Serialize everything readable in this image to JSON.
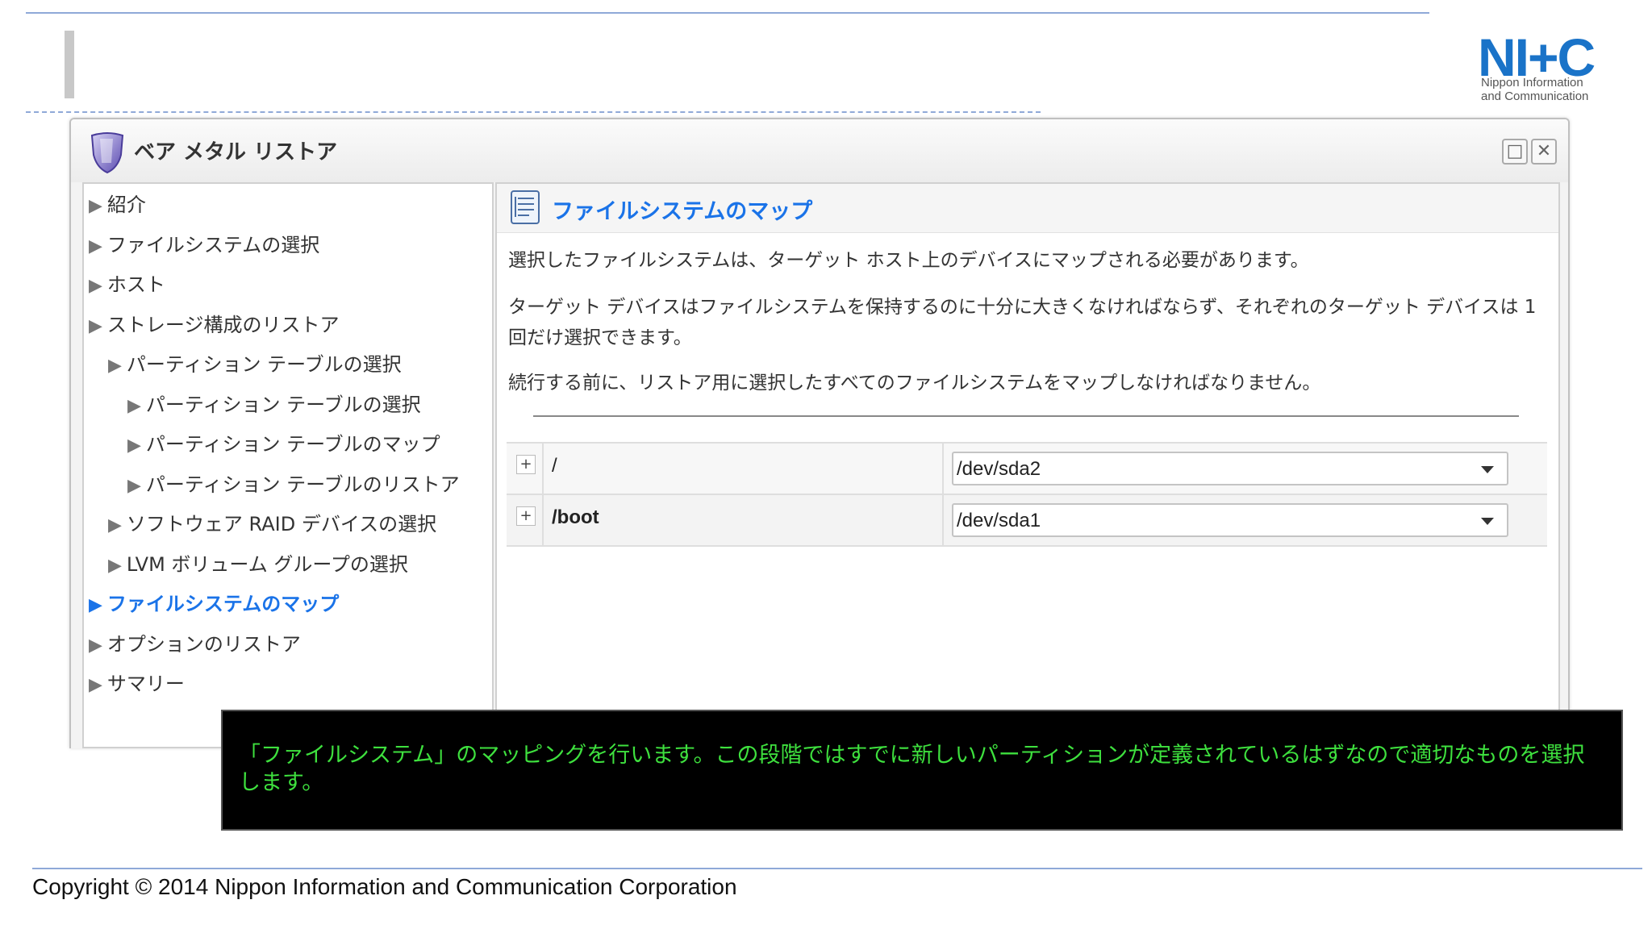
{
  "logo": {
    "mark": "NI+C",
    "line1": "Nippon Information",
    "line2": "and Communication"
  },
  "window": {
    "title": "ベア メタル リストア",
    "maximize_glyph": "□",
    "close_glyph": "✕"
  },
  "nav": {
    "items": [
      {
        "label": "紹介",
        "level": 0,
        "active": false
      },
      {
        "label": "ファイルシステムの選択",
        "level": 0,
        "active": false
      },
      {
        "label": "ホスト",
        "level": 0,
        "active": false
      },
      {
        "label": "ストレージ構成のリストア",
        "level": 0,
        "active": false
      },
      {
        "label": "パーティション テーブルの選択",
        "level": 1,
        "active": false
      },
      {
        "label": "パーティション テーブルの選択",
        "level": 2,
        "active": false
      },
      {
        "label": "パーティション テーブルのマップ",
        "level": 2,
        "active": false
      },
      {
        "label": "パーティション テーブルのリストア",
        "level": 2,
        "active": false
      },
      {
        "label": "ソフトウェア RAID デバイスの選択",
        "level": 1,
        "active": false
      },
      {
        "label": "LVM ボリューム グループの選択",
        "level": 1,
        "active": false
      },
      {
        "label": "ファイルシステムのマップ",
        "level": 0,
        "active": true
      },
      {
        "label": "オプションのリストア",
        "level": 0,
        "active": false
      },
      {
        "label": "サマリー",
        "level": 0,
        "active": false
      }
    ]
  },
  "content": {
    "title": "ファイルシステムのマップ",
    "para1": "選択したファイルシステムは、ターゲット ホスト上のデバイスにマップされる必要があります。",
    "para2": "ターゲット デバイスはファイルシステムを保持するのに十分に大きくなければならず、それぞれのターゲット デバイスは 1 回だけ選択できます。",
    "para3": "続行する前に、リストア用に選択したすべてのファイルシステムをマップしなければなりません。",
    "rows": [
      {
        "expander": "+",
        "mount": "/",
        "device": "/dev/sda2"
      },
      {
        "expander": "+",
        "mount": "/boot",
        "device": "/dev/sda1"
      }
    ]
  },
  "caption": {
    "text": "「ファイルシステム」のマッピングを行います。この段階ではすでに新しいパーティションが定義されているはずなので適切なものを選択します。"
  },
  "footer": {
    "copyright": "Copyright © 2014 Nippon Information and Communication Corporation"
  },
  "colors": {
    "accent": "#1a73e8",
    "caption_text": "#3ee03e",
    "caption_bg": "#000000",
    "rule": "#8fa9d8"
  }
}
